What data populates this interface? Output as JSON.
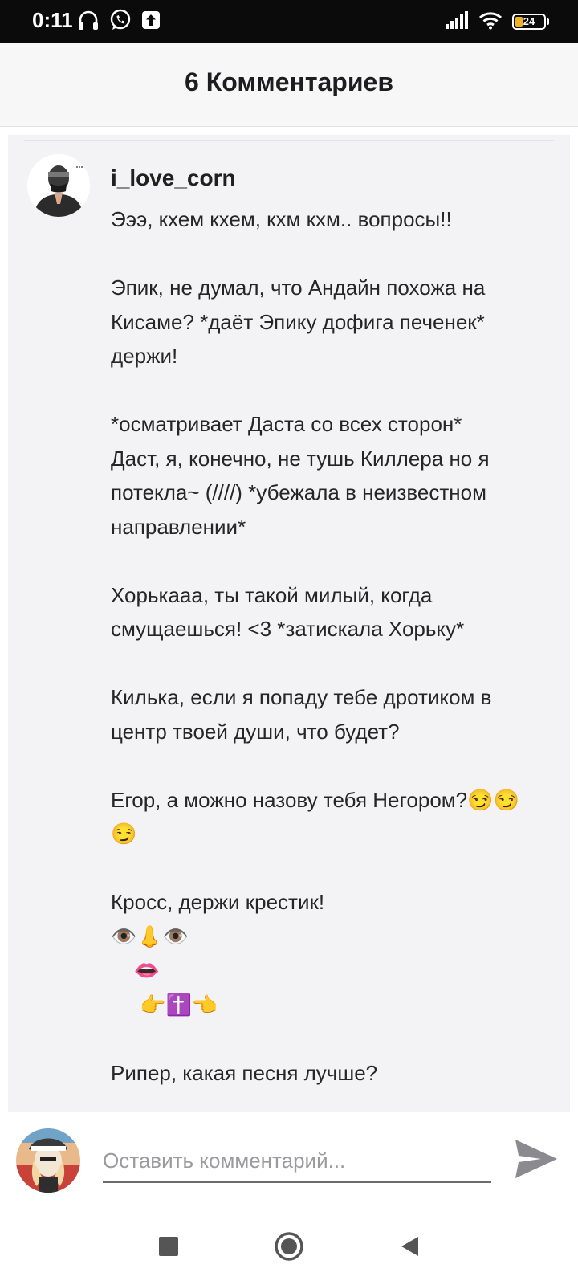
{
  "status_bar": {
    "time": "0:11",
    "battery_level": "24",
    "icons": [
      "headphones-icon",
      "whatsapp-icon",
      "upload-icon",
      "signal-icon",
      "wifi-icon",
      "battery-icon"
    ]
  },
  "header": {
    "title": "6 Комментариев"
  },
  "comment": {
    "author": "i_love_corn",
    "lines": [
      "Эээ, кхем кхем, кхм кхм.. вопросы!!",
      "",
      "Эпик, не думал, что Андайн похожа на",
      "Кисаме? *даёт Эпику дофига печенек*",
      "держи!",
      "",
      "*осматривает Даста со всех сторон*",
      "Даст, я, конечно, не тушь Киллера но я",
      "потекла~ (////) *убежала в неизвестном",
      "направлении*",
      "",
      "Хорькааа, ты такой милый, когда",
      "смущаешься! <3 *затискала Хорьку*",
      "",
      "Килька, если я попаду тебе дротиком в",
      "центр твоей души, что будет?",
      "",
      "Егор, а можно назову тебя Негором?😏😏",
      "😏",
      "",
      "Кросс, держи крестик!",
      "👁️👃👁️",
      "    👄",
      "     👉✝️👈",
      "",
      "Рипер, какая песня лучше?"
    ]
  },
  "input": {
    "placeholder": "Оставить комментарий..."
  },
  "colors": {
    "status_bar_bg": "#0b0b0b",
    "header_bg": "#f7f7f8",
    "card_bg": "#f3f3f6",
    "send_icon": "#8a8a8f",
    "battery_fill": "#f0b323"
  }
}
